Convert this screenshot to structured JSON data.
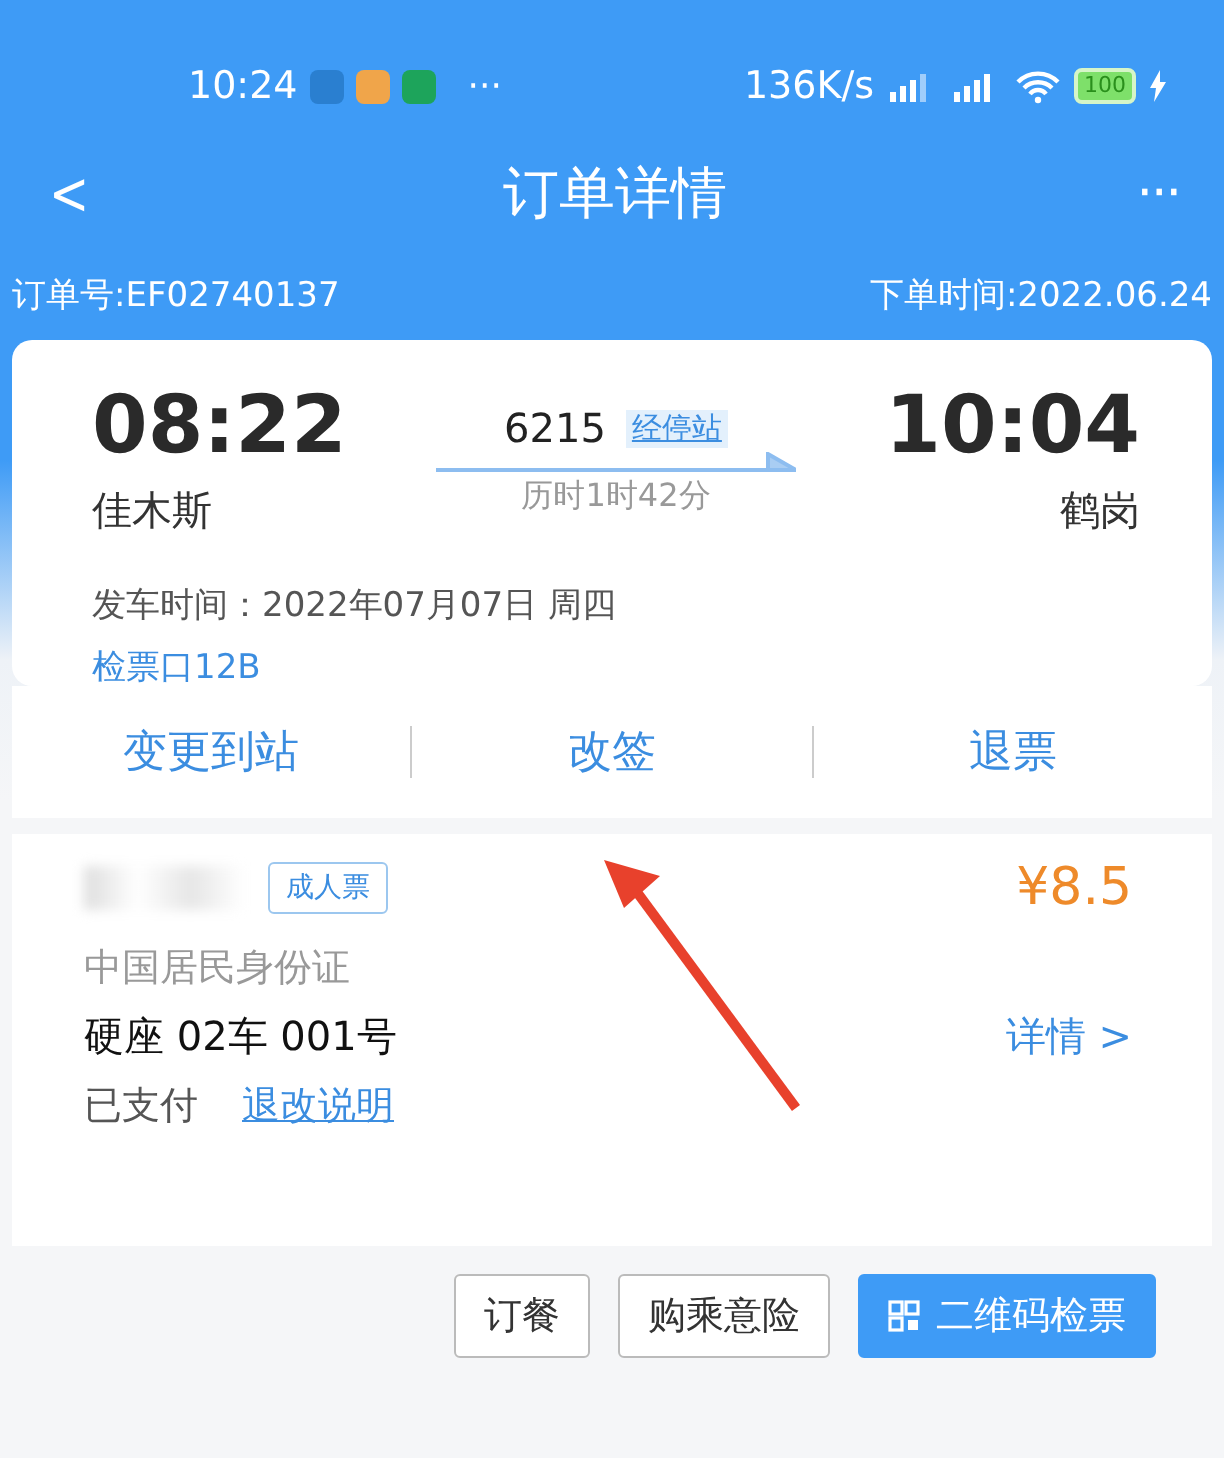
{
  "status_bar": {
    "time": "10:24",
    "more": "···",
    "speed": "136K/s",
    "battery": "100"
  },
  "nav": {
    "back": "<",
    "title": "订单详情",
    "more": "···"
  },
  "order": {
    "number": "订单号:EF02740137",
    "date": "下单时间:2022.06.24"
  },
  "trip": {
    "depart_time": "08:22",
    "depart_station": "佳木斯",
    "train": "6215",
    "stops_link": "经停站",
    "duration": "历时1时42分",
    "arrive_time": "10:04",
    "arrive_station": "鹤岗",
    "departure_date": "发车时间：2022年07月07日 周四",
    "gate": "检票口12B"
  },
  "actions": [
    "变更到站",
    "改签",
    "退票"
  ],
  "passenger": {
    "ticket_type": "成人票",
    "price": "¥8.5",
    "id_type": "中国居民身份证",
    "seat": "硬座 02车 001号",
    "detail": "详情 >",
    "status": "已支付",
    "rules_link": "退改说明"
  },
  "buttons": [
    {
      "label": "订餐",
      "kind": "outline"
    },
    {
      "label": "购乘意险",
      "kind": "outline"
    },
    {
      "label": "二维码检票",
      "kind": "primary"
    }
  ]
}
